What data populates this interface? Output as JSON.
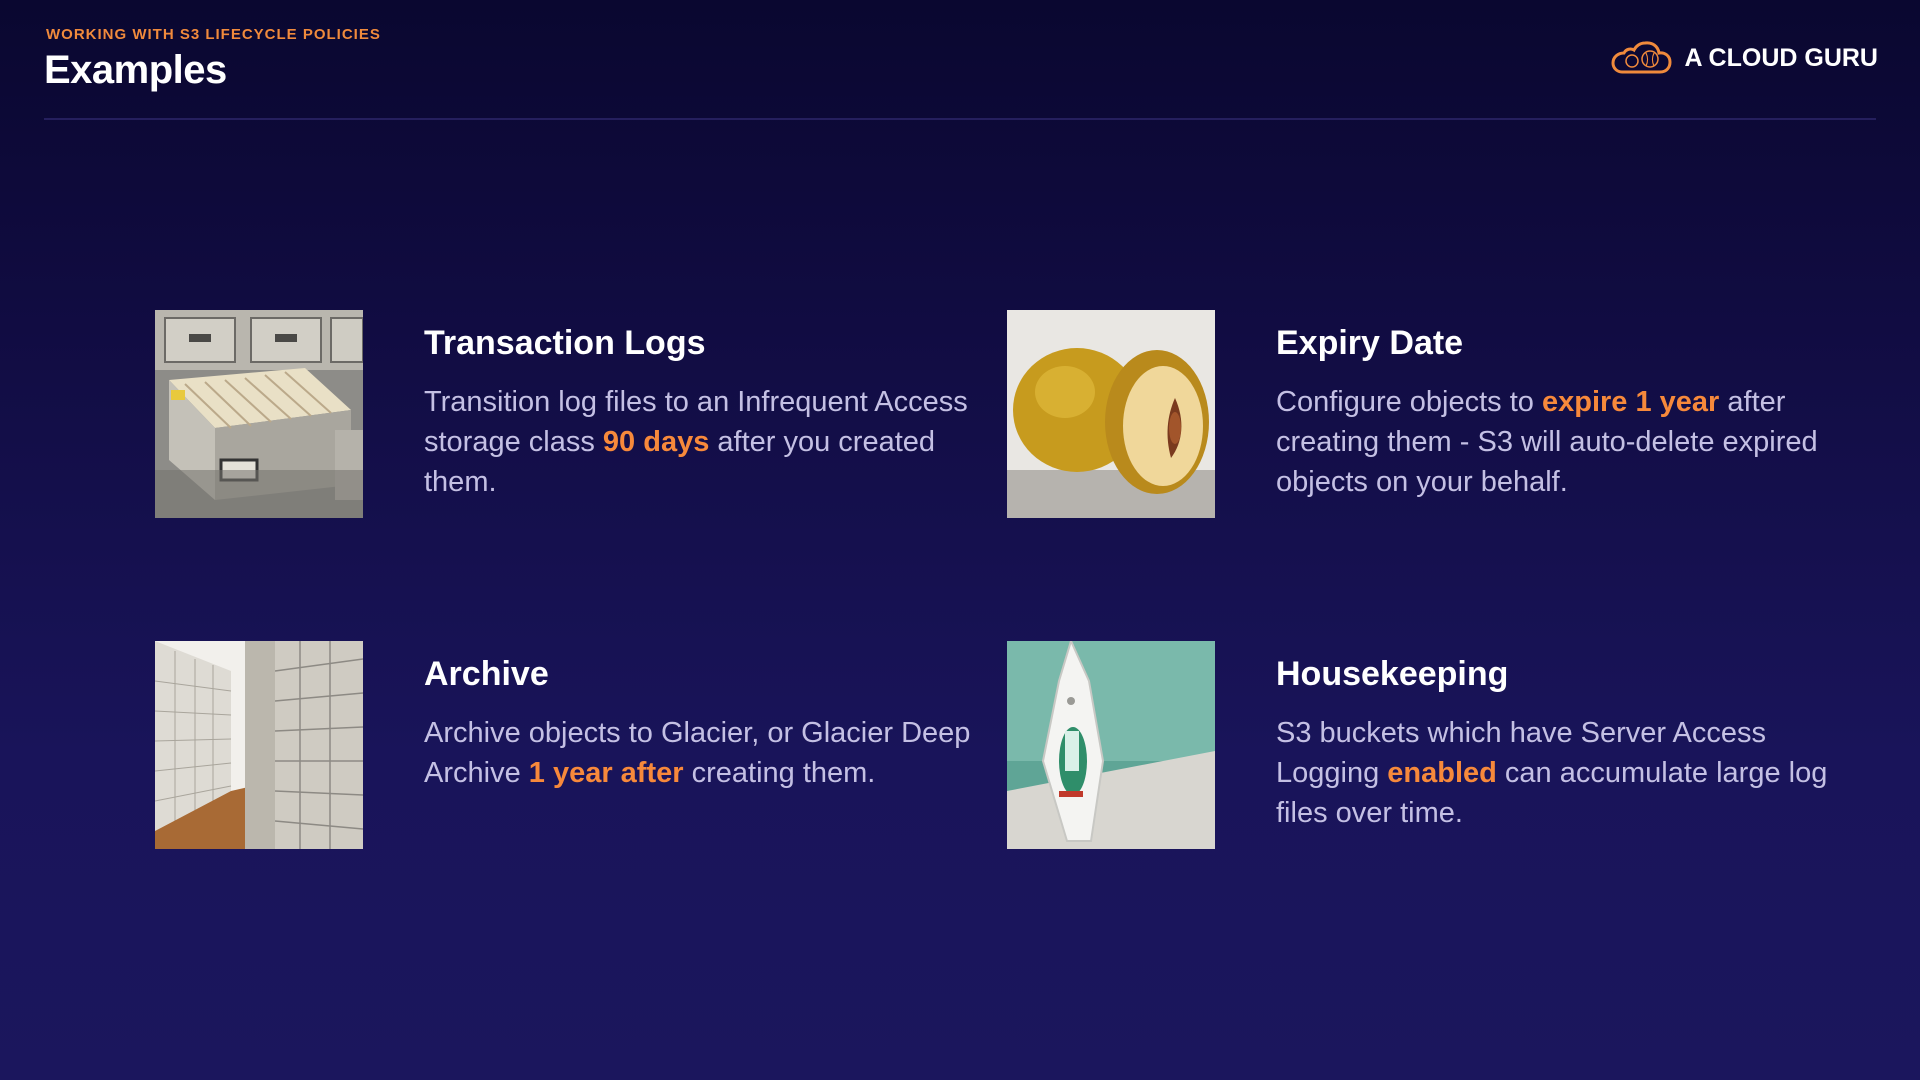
{
  "header": {
    "eyebrow": "WORKING WITH S3 LIFECYCLE POLICIES",
    "title": "Examples",
    "brand": "A CLOUD GURU",
    "brand_icon": "cloud-logo-icon",
    "accent_color": "#f7893b"
  },
  "cards": [
    {
      "title": "Transaction Logs",
      "image": "filing-cabinet-image",
      "text_before": "Transition log files to an Infrequent Access storage class ",
      "highlight": "90 days",
      "text_after": " after you created them."
    },
    {
      "title": "Expiry Date",
      "image": "quince-fruit-image",
      "text_before": "Configure objects to ",
      "highlight": "expire 1 year",
      "text_after": " after creating them - S3 will auto-delete expired objects on your behalf."
    },
    {
      "title": "Archive",
      "image": "archive-shelves-image",
      "text_before": "Archive objects to Glacier, or Glacier Deep Archive ",
      "highlight": "1 year after",
      "text_after": " creating them."
    },
    {
      "title": "Housekeeping",
      "image": "clothes-iron-image",
      "text_before": "S3 buckets which have Server Access Logging ",
      "highlight": "enabled",
      "text_after": " can accumulate large log files over time."
    }
  ]
}
